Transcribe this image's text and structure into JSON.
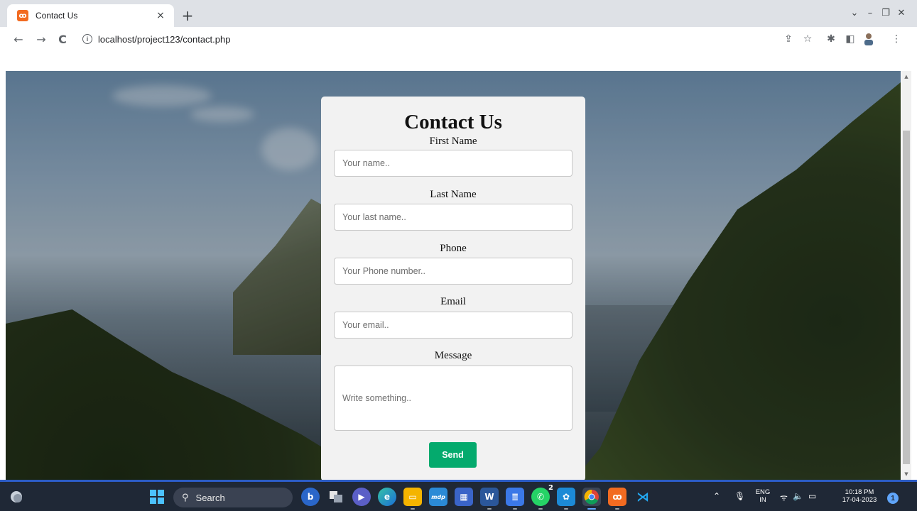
{
  "browser": {
    "tab_title": "Contact Us",
    "tab_favicon": "xampp-icon",
    "tab_close": "×",
    "new_tab": "+",
    "url": "localhost/project123/contact.php",
    "window_controls": {
      "dropdown": "⌄",
      "minimize": "–",
      "restore": "❐",
      "close": "✕"
    },
    "nav": {
      "back": "←",
      "forward": "→",
      "reload": "C"
    },
    "toolbar_icons": {
      "share": "⇪",
      "bookmark": "☆",
      "extensions": "✱",
      "sidepanel": "◧",
      "menu": "⋮"
    }
  },
  "form": {
    "title": "Contact Us",
    "first_name_label": "First Name",
    "first_name_placeholder": "Your name..",
    "last_name_label": "Last Name",
    "last_name_placeholder": "Your last name..",
    "phone_label": "Phone",
    "phone_placeholder": "Your Phone number..",
    "email_label": "Email",
    "email_placeholder": "Your email..",
    "message_label": "Message",
    "message_placeholder": "Write something..",
    "send_label": "Send"
  },
  "taskbar": {
    "search_label": "Search",
    "language": "ENG",
    "region": "IN",
    "time": "10:18 PM",
    "date": "17-04-2023",
    "notification_count": "1",
    "whatsapp_badge": "2",
    "apps": [
      "weather-icon",
      "start-icon",
      "bing-icon",
      "task-view-icon",
      "teams-icon",
      "edge-icon",
      "file-explorer-icon",
      "mobile-app-icon",
      "store-icon",
      "word-icon",
      "notepad-icon",
      "whatsapp-icon",
      "photos-icon",
      "chrome-icon",
      "xampp-icon",
      "vscode-icon"
    ]
  },
  "colors": {
    "send_button": "#04aa6d",
    "card_background": "#f2f2f2",
    "taskbar": "#1f2836"
  }
}
